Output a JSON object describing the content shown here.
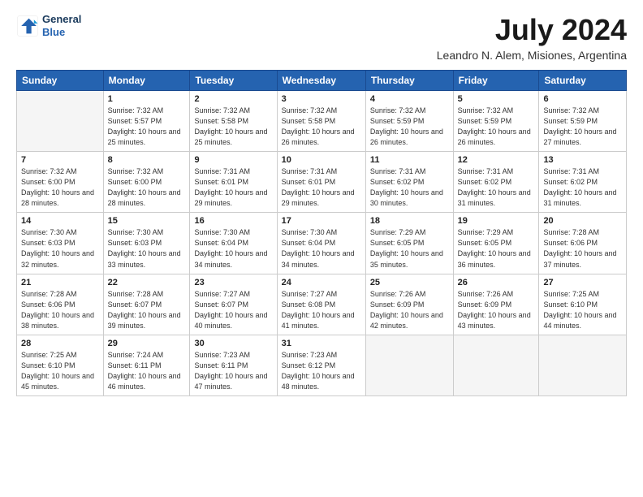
{
  "header": {
    "logo_general": "General",
    "logo_blue": "Blue",
    "month": "July 2024",
    "location": "Leandro N. Alem, Misiones, Argentina"
  },
  "days_of_week": [
    "Sunday",
    "Monday",
    "Tuesday",
    "Wednesday",
    "Thursday",
    "Friday",
    "Saturday"
  ],
  "weeks": [
    [
      null,
      {
        "day": 1,
        "sunrise": "7:32 AM",
        "sunset": "5:57 PM",
        "daylight": "10 hours and 25 minutes."
      },
      {
        "day": 2,
        "sunrise": "7:32 AM",
        "sunset": "5:58 PM",
        "daylight": "10 hours and 25 minutes."
      },
      {
        "day": 3,
        "sunrise": "7:32 AM",
        "sunset": "5:58 PM",
        "daylight": "10 hours and 26 minutes."
      },
      {
        "day": 4,
        "sunrise": "7:32 AM",
        "sunset": "5:59 PM",
        "daylight": "10 hours and 26 minutes."
      },
      {
        "day": 5,
        "sunrise": "7:32 AM",
        "sunset": "5:59 PM",
        "daylight": "10 hours and 26 minutes."
      },
      {
        "day": 6,
        "sunrise": "7:32 AM",
        "sunset": "5:59 PM",
        "daylight": "10 hours and 27 minutes."
      }
    ],
    [
      {
        "day": 7,
        "sunrise": "7:32 AM",
        "sunset": "6:00 PM",
        "daylight": "10 hours and 28 minutes."
      },
      {
        "day": 8,
        "sunrise": "7:32 AM",
        "sunset": "6:00 PM",
        "daylight": "10 hours and 28 minutes."
      },
      {
        "day": 9,
        "sunrise": "7:31 AM",
        "sunset": "6:01 PM",
        "daylight": "10 hours and 29 minutes."
      },
      {
        "day": 10,
        "sunrise": "7:31 AM",
        "sunset": "6:01 PM",
        "daylight": "10 hours and 29 minutes."
      },
      {
        "day": 11,
        "sunrise": "7:31 AM",
        "sunset": "6:02 PM",
        "daylight": "10 hours and 30 minutes."
      },
      {
        "day": 12,
        "sunrise": "7:31 AM",
        "sunset": "6:02 PM",
        "daylight": "10 hours and 31 minutes."
      },
      {
        "day": 13,
        "sunrise": "7:31 AM",
        "sunset": "6:02 PM",
        "daylight": "10 hours and 31 minutes."
      }
    ],
    [
      {
        "day": 14,
        "sunrise": "7:30 AM",
        "sunset": "6:03 PM",
        "daylight": "10 hours and 32 minutes."
      },
      {
        "day": 15,
        "sunrise": "7:30 AM",
        "sunset": "6:03 PM",
        "daylight": "10 hours and 33 minutes."
      },
      {
        "day": 16,
        "sunrise": "7:30 AM",
        "sunset": "6:04 PM",
        "daylight": "10 hours and 34 minutes."
      },
      {
        "day": 17,
        "sunrise": "7:30 AM",
        "sunset": "6:04 PM",
        "daylight": "10 hours and 34 minutes."
      },
      {
        "day": 18,
        "sunrise": "7:29 AM",
        "sunset": "6:05 PM",
        "daylight": "10 hours and 35 minutes."
      },
      {
        "day": 19,
        "sunrise": "7:29 AM",
        "sunset": "6:05 PM",
        "daylight": "10 hours and 36 minutes."
      },
      {
        "day": 20,
        "sunrise": "7:28 AM",
        "sunset": "6:06 PM",
        "daylight": "10 hours and 37 minutes."
      }
    ],
    [
      {
        "day": 21,
        "sunrise": "7:28 AM",
        "sunset": "6:06 PM",
        "daylight": "10 hours and 38 minutes."
      },
      {
        "day": 22,
        "sunrise": "7:28 AM",
        "sunset": "6:07 PM",
        "daylight": "10 hours and 39 minutes."
      },
      {
        "day": 23,
        "sunrise": "7:27 AM",
        "sunset": "6:07 PM",
        "daylight": "10 hours and 40 minutes."
      },
      {
        "day": 24,
        "sunrise": "7:27 AM",
        "sunset": "6:08 PM",
        "daylight": "10 hours and 41 minutes."
      },
      {
        "day": 25,
        "sunrise": "7:26 AM",
        "sunset": "6:09 PM",
        "daylight": "10 hours and 42 minutes."
      },
      {
        "day": 26,
        "sunrise": "7:26 AM",
        "sunset": "6:09 PM",
        "daylight": "10 hours and 43 minutes."
      },
      {
        "day": 27,
        "sunrise": "7:25 AM",
        "sunset": "6:10 PM",
        "daylight": "10 hours and 44 minutes."
      }
    ],
    [
      {
        "day": 28,
        "sunrise": "7:25 AM",
        "sunset": "6:10 PM",
        "daylight": "10 hours and 45 minutes."
      },
      {
        "day": 29,
        "sunrise": "7:24 AM",
        "sunset": "6:11 PM",
        "daylight": "10 hours and 46 minutes."
      },
      {
        "day": 30,
        "sunrise": "7:23 AM",
        "sunset": "6:11 PM",
        "daylight": "10 hours and 47 minutes."
      },
      {
        "day": 31,
        "sunrise": "7:23 AM",
        "sunset": "6:12 PM",
        "daylight": "10 hours and 48 minutes."
      },
      null,
      null,
      null
    ]
  ]
}
